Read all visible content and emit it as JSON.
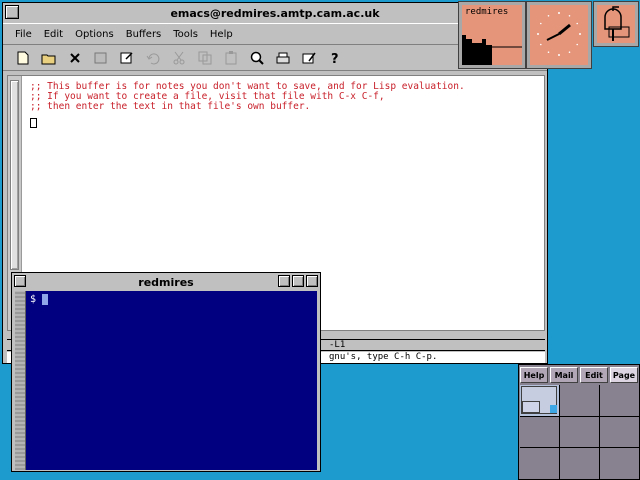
{
  "emacs": {
    "title": "emacs@redmires.amtp.cam.ac.uk",
    "menu": [
      "File",
      "Edit",
      "Options",
      "Buffers",
      "Tools",
      "Help"
    ],
    "toolbar_icons": [
      "new-file-icon",
      "open-folder-icon",
      "close-icon",
      "save-icon",
      "save-as-icon",
      "undo-icon",
      "cut-icon",
      "copy-icon",
      "paste-icon",
      "search-icon",
      "print-icon",
      "preferences-icon",
      "help-icon"
    ],
    "buffer_lines": [
      ";; This buffer is for notes you don't want to save, and for Lisp evaluation.",
      ";; If you want to create a file, visit that file with C-x C-f,",
      ";; then enter the text in that file's own buffer."
    ],
    "modeline_fragment": "-L1",
    "echo_fragment": "gnu's, type C-h C-p."
  },
  "xterm": {
    "title": "redmires",
    "prompt": "$"
  },
  "xload": {
    "host": "redmires"
  },
  "pager": {
    "tabs": [
      "Help",
      "Mail",
      "Edit",
      "Page"
    ],
    "current_tab": "Page"
  },
  "colors": {
    "desktop": "#1d9bcf",
    "comment_text": "#c8202a",
    "xterm_bg": "#000080",
    "widget_bg": "#e4957a"
  }
}
